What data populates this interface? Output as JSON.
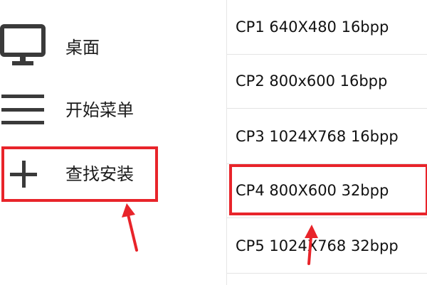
{
  "menu": {
    "items": [
      {
        "label": "桌面",
        "icon": "monitor-icon"
      },
      {
        "label": "开始菜单",
        "icon": "hamburger-menu-icon"
      },
      {
        "label": "查找安装",
        "icon": "plus-icon"
      }
    ]
  },
  "resolutions": {
    "items": [
      {
        "label": "CP1 640X480 16bpp"
      },
      {
        "label": "CP2 800x600 16bpp"
      },
      {
        "label": "CP3 1024X768 16bpp"
      },
      {
        "label": "CP4 800X600 32bpp"
      },
      {
        "label": "CP5 1024X768 32bpp"
      }
    ]
  },
  "colors": {
    "highlight": "#e8242a",
    "icon": "#3a3a3a",
    "divider": "#e4e4e4"
  }
}
